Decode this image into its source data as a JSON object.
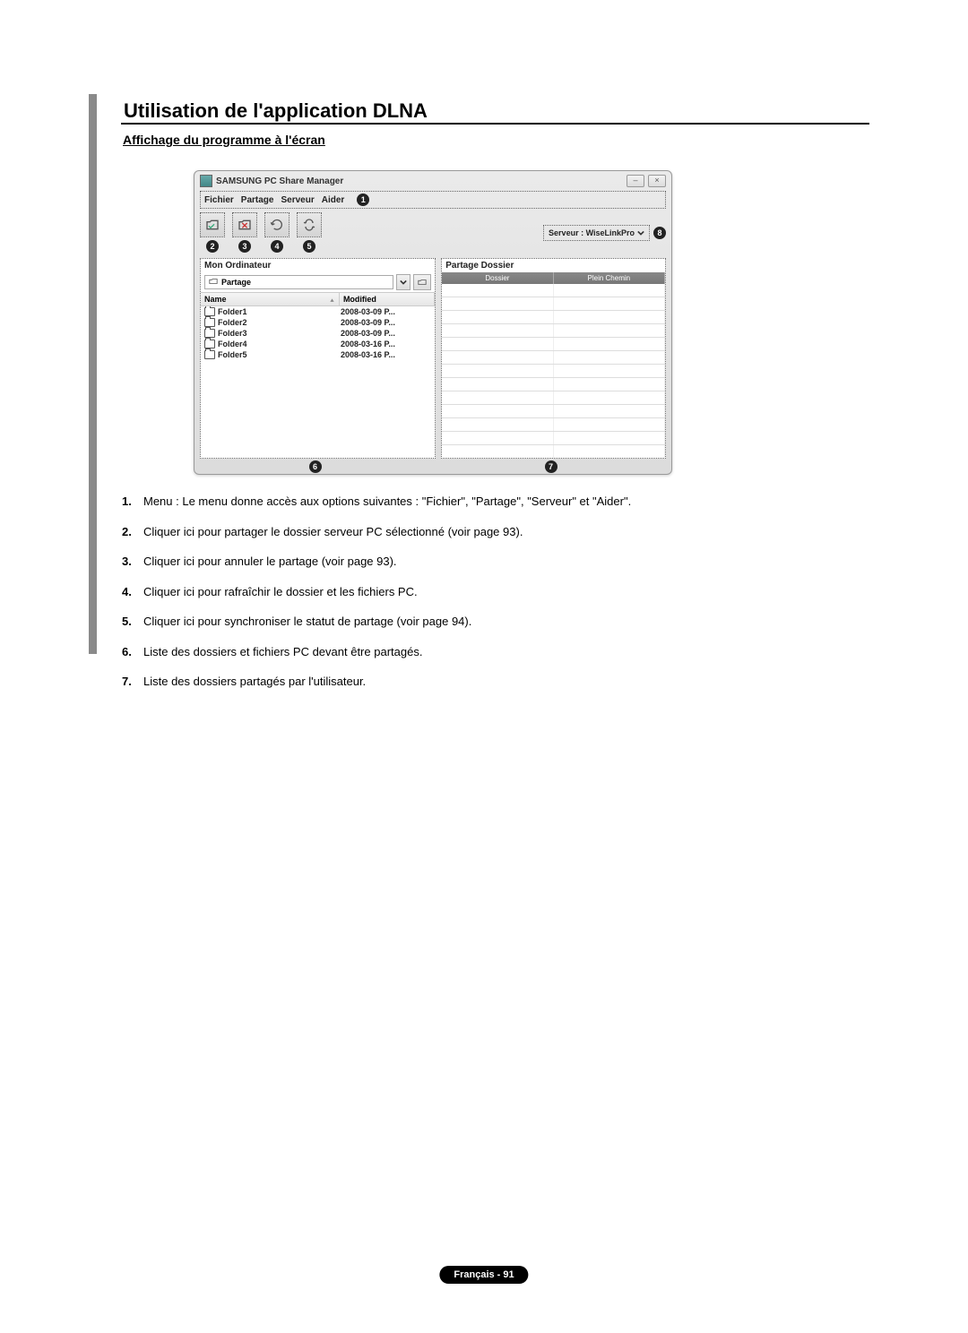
{
  "page": {
    "title": "Utilisation de l'application DLNA",
    "subtitle": "Affichage du programme à l'écran"
  },
  "window": {
    "app_title": "SAMSUNG PC Share Manager",
    "menubar": {
      "items": [
        "Fichier",
        "Partage",
        "Serveur",
        "Aider"
      ]
    },
    "server_label": "Serveur : WiseLinkPro",
    "panes": {
      "left_title": "Mon Ordinateur",
      "right_title": "Partage Dossier",
      "partage_label": "Partage",
      "col_name": "Name",
      "col_modified": "Modified",
      "folders": [
        {
          "name": "Folder1",
          "modified": "2008-03-09 P..."
        },
        {
          "name": "Folder2",
          "modified": "2008-03-09 P..."
        },
        {
          "name": "Folder3",
          "modified": "2008-03-09 P..."
        },
        {
          "name": "Folder4",
          "modified": "2008-03-16 P..."
        },
        {
          "name": "Folder5",
          "modified": "2008-03-16 P..."
        }
      ],
      "right_cols": {
        "dossier": "Dossier",
        "plein": "Plein Chemin"
      }
    },
    "badges": {
      "b1": "1",
      "b2": "2",
      "b3": "3",
      "b4": "4",
      "b5": "5",
      "b6": "6",
      "b7": "7",
      "b8": "8"
    }
  },
  "list": {
    "items": [
      {
        "n": "1.",
        "t": "Menu : Le menu donne accès aux options suivantes : \"Fichier\", \"Partage\", \"Serveur\" et \"Aider\"."
      },
      {
        "n": "2.",
        "t": "Cliquer ici pour partager le dossier serveur PC sélectionné (voir page 93)."
      },
      {
        "n": "3.",
        "t": "Cliquer ici pour annuler le partage (voir page 93)."
      },
      {
        "n": "4.",
        "t": "Cliquer ici pour rafraîchir le dossier et les fichiers PC."
      },
      {
        "n": "5.",
        "t": "Cliquer ici pour synchroniser le statut de partage (voir page 94)."
      },
      {
        "n": "6.",
        "t": "Liste des dossiers et fichiers PC devant être partagés."
      },
      {
        "n": "7.",
        "t": "Liste des dossiers partagés par l'utilisateur."
      }
    ]
  },
  "footer": {
    "text": "Français - 91"
  }
}
